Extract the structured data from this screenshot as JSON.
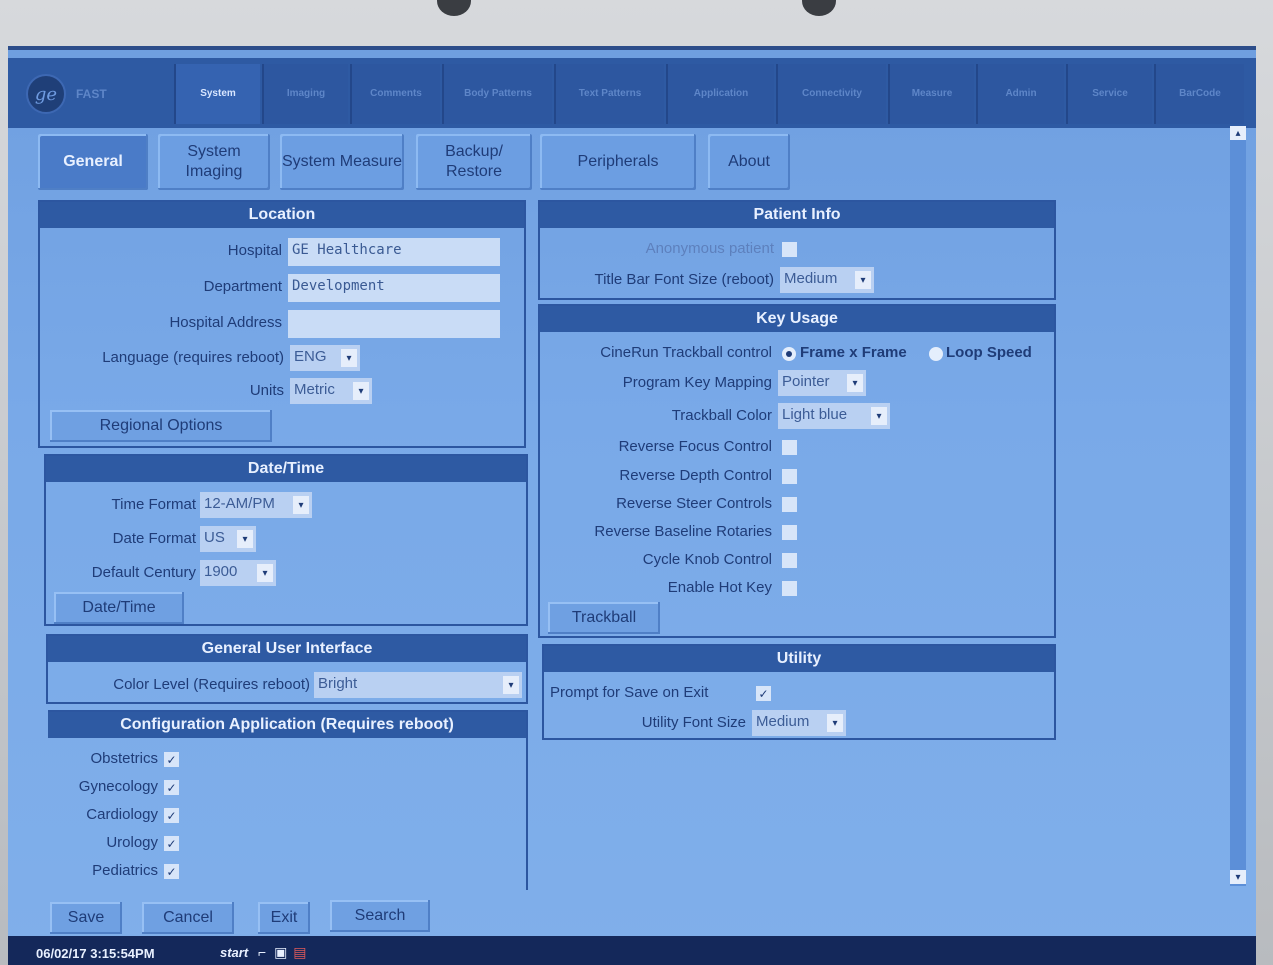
{
  "app": {
    "product": "FAST"
  },
  "top_tabs": [
    {
      "label": "System"
    },
    {
      "label": "Imaging"
    },
    {
      "label": "Comments"
    },
    {
      "label": "Body Patterns"
    },
    {
      "label": "Text Patterns"
    },
    {
      "label": "Application"
    },
    {
      "label": "Connectivity"
    },
    {
      "label": "Measure"
    },
    {
      "label": "Admin"
    },
    {
      "label": "Service"
    },
    {
      "label": "BarCode"
    }
  ],
  "sub_tabs": [
    {
      "label": "General"
    },
    {
      "label": "System Imaging"
    },
    {
      "label": "System Measure"
    },
    {
      "label": "Backup/ Restore"
    },
    {
      "label": "Peripherals"
    },
    {
      "label": "About"
    }
  ],
  "location": {
    "title": "Location",
    "hospital_label": "Hospital",
    "hospital_value": "GE Healthcare",
    "department_label": "Department",
    "department_value": "Development",
    "address_label": "Hospital Address",
    "address_value": "",
    "language_label": "Language (requires reboot)",
    "language_value": "ENG",
    "units_label": "Units",
    "units_value": "Metric",
    "regional_button": "Regional Options"
  },
  "datetime": {
    "title": "Date/Time",
    "time_format_label": "Time Format",
    "time_format_value": "12-AM/PM",
    "date_format_label": "Date Format",
    "date_format_value": "US",
    "century_label": "Default Century",
    "century_value": "1900",
    "button": "Date/Time"
  },
  "gui": {
    "title": "General User Interface",
    "color_level_label": "Color Level (Requires reboot)",
    "color_level_value": "Bright"
  },
  "config_app": {
    "title": "Configuration Application (Requires reboot)",
    "items": [
      {
        "label": "Obstetrics",
        "checked": "✓"
      },
      {
        "label": "Gynecology",
        "checked": "✓"
      },
      {
        "label": "Cardiology",
        "checked": "✓"
      },
      {
        "label": "Urology",
        "checked": "✓"
      },
      {
        "label": "Pediatrics",
        "checked": "✓"
      }
    ]
  },
  "patient_info": {
    "title": "Patient Info",
    "anon_label": "Anonymous patient",
    "font_label": "Title Bar Font Size (reboot)",
    "font_value": "Medium"
  },
  "key_usage": {
    "title": "Key Usage",
    "cinerun_label": "CineRun Trackball control",
    "radio_frame": "Frame x Frame",
    "radio_loop": "Loop Speed",
    "mapping_label": "Program Key Mapping",
    "mapping_value": "Pointer",
    "trackball_color_label": "Trackball Color",
    "trackball_color_value": "Light blue",
    "checks": [
      {
        "label": "Reverse Focus Control"
      },
      {
        "label": "Reverse Depth Control"
      },
      {
        "label": "Reverse Steer Controls"
      },
      {
        "label": "Reverse Baseline Rotaries"
      },
      {
        "label": "Cycle Knob Control"
      },
      {
        "label": "Enable Hot Key"
      }
    ],
    "trackball_button": "Trackball"
  },
  "utility": {
    "title": "Utility",
    "prompt_label": "Prompt for Save on Exit",
    "prompt_checked": "✓",
    "font_label": "Utility Font Size",
    "font_value": "Medium"
  },
  "footer_buttons": {
    "save": "Save",
    "cancel": "Cancel",
    "exit": "Exit",
    "search": "Search"
  },
  "taskbar": {
    "datetime": "06/02/17 3:15:54PM",
    "start": "start"
  },
  "icons": {
    "dropdown": "▾",
    "scroll_up": "▴",
    "scroll_down": "▾"
  }
}
